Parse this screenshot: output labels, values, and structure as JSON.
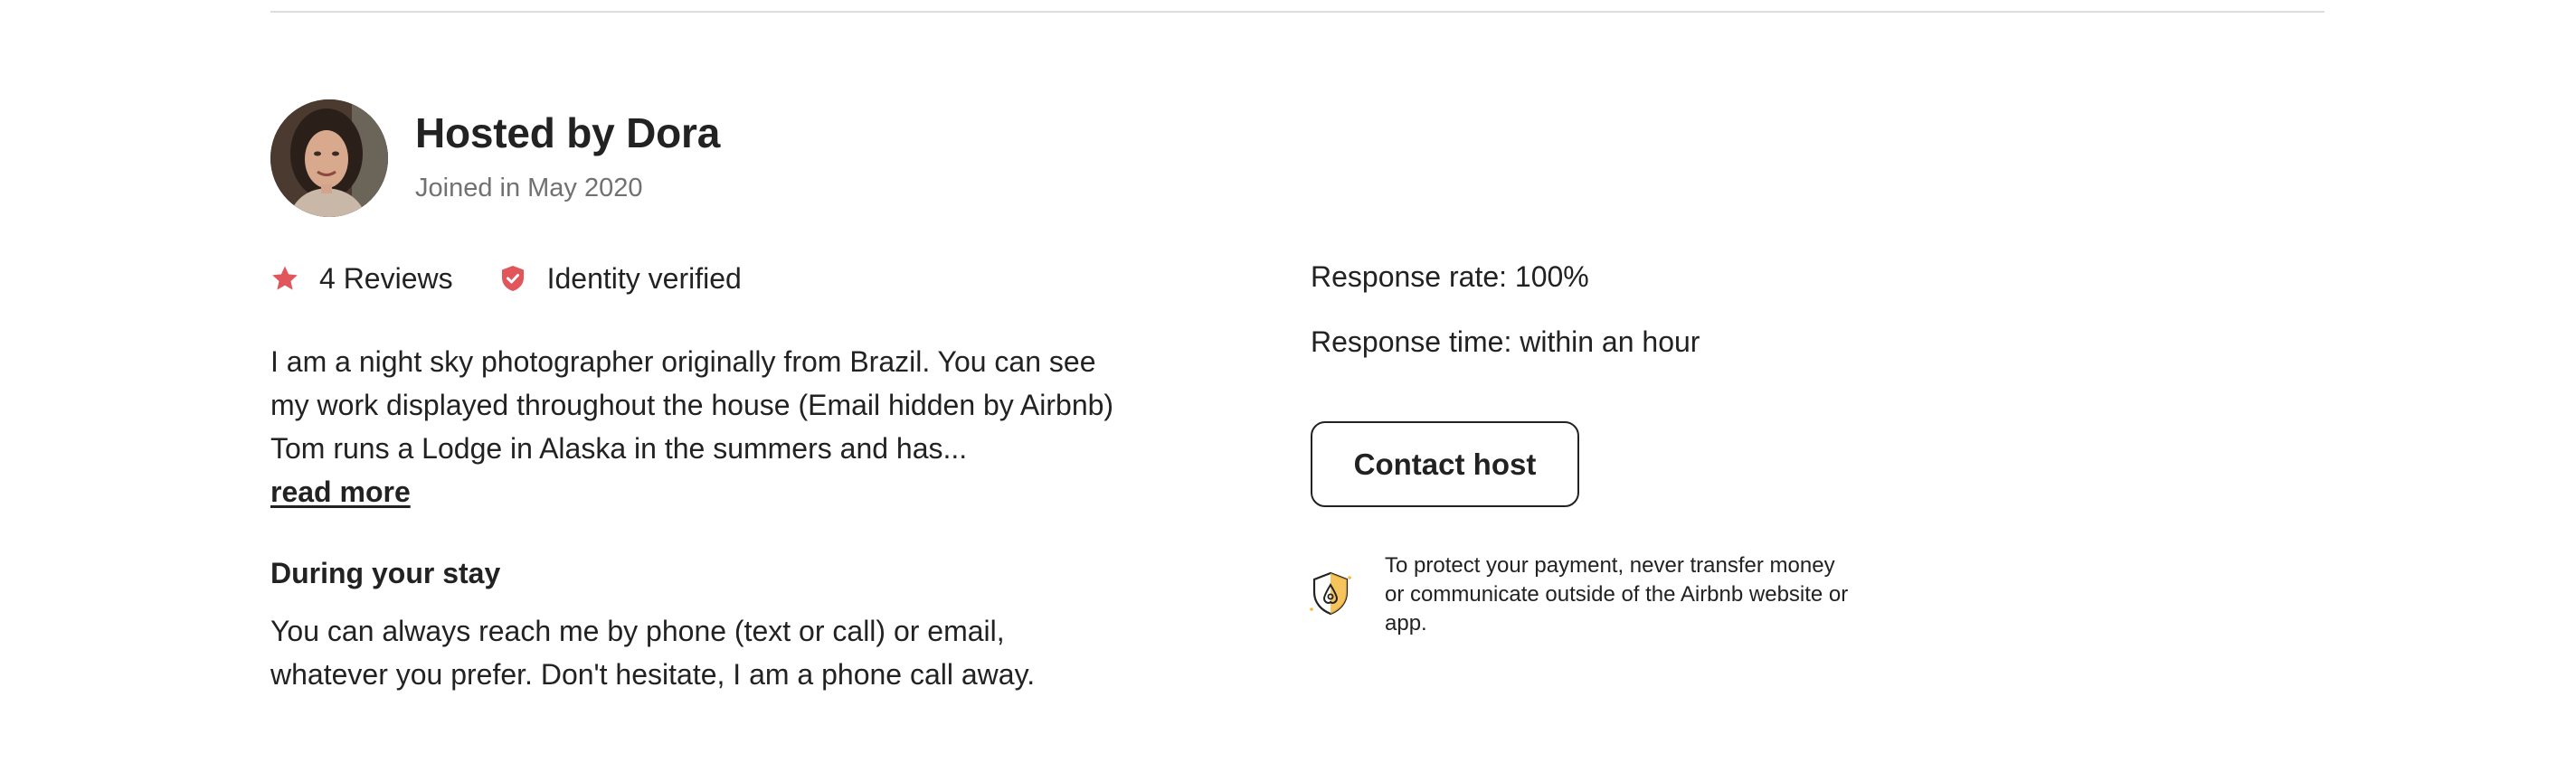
{
  "host": {
    "title": "Hosted by Dora",
    "joined": "Joined in May 2020",
    "avatar_icon": "host-avatar-photo"
  },
  "badges": {
    "reviews": {
      "icon": "star-icon",
      "label": "4 Reviews",
      "color": "#e0565b"
    },
    "identity": {
      "icon": "shield-check-icon",
      "label": "Identity verified",
      "color": "#e0565b"
    }
  },
  "about": {
    "text": "I am a night sky photographer originally from Brazil. You can see my work displayed throughout the house (Email hidden by Airbnb) Tom runs a Lodge in Alaska in the summers and has...",
    "read_more": "read more"
  },
  "during_stay": {
    "heading": "During your stay",
    "text": "You can always reach me by phone (text or call) or email, whatever you prefer. Don't hesitate, I am a phone call away."
  },
  "response": {
    "rate": "Response rate: 100%",
    "time": "Response time: within an hour"
  },
  "contact": {
    "button_label": "Contact host"
  },
  "protection": {
    "icon": "payment-protection-shield-icon",
    "text": "To protect your payment, never transfer money or communicate outside of the Airbnb website or app.",
    "accent_color": "#f5b841"
  }
}
